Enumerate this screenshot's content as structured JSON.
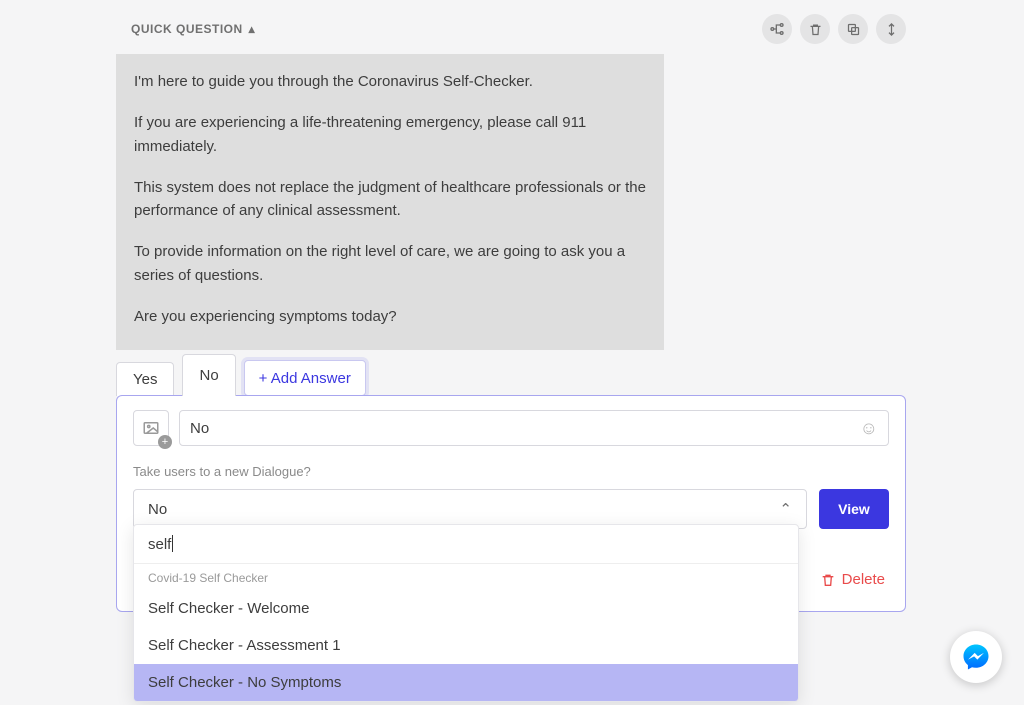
{
  "header": {
    "section_title": "QUICK QUESTION",
    "toolbar_icons": {
      "flow": "flow-icon",
      "trash": "trash-icon",
      "copy": "copy-icon",
      "move": "move-icon"
    }
  },
  "message": {
    "p1": "I'm here to guide you through the Coronavirus Self-Checker.",
    "p2": "If you are experiencing a life-threatening emergency, please call 911 immediately.",
    "p3": "This system does not replace the judgment of healthcare professionals or the performance of any clinical assessment.",
    "p4": "To provide information on the right level of care, we are going to ask you a series of questions.",
    "p5": "Are you experiencing symptoms today?"
  },
  "tabs": {
    "yes": "Yes",
    "no": "No",
    "add": "+ Add Answer"
  },
  "answer": {
    "input_value": "No",
    "dialogue_label": "Take users to a new Dialogue?",
    "dialogue_selected": "No",
    "view_label": "View",
    "delete_label": "Delete"
  },
  "dropdown": {
    "search_value": "self",
    "group_label": "Covid-19 Self Checker",
    "options": [
      "Self Checker - Welcome",
      "Self Checker - Assessment 1",
      "Self Checker - No Symptoms"
    ],
    "highlighted_index": 2
  }
}
